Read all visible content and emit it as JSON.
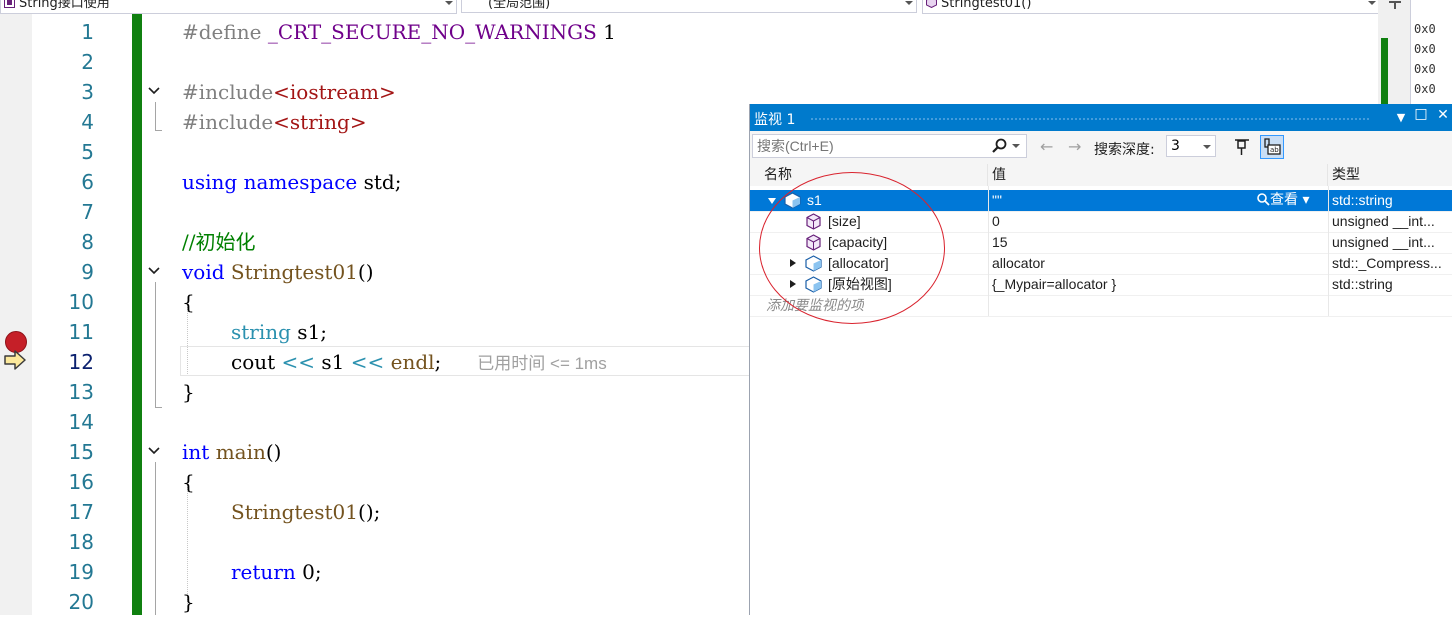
{
  "navbar": {
    "project": "String接口使用",
    "scope": "(全局范围)",
    "member": "Stringtest01()"
  },
  "editor": {
    "line_numbers": [
      "1",
      "2",
      "3",
      "4",
      "5",
      "6",
      "7",
      "8",
      "9",
      "10",
      "11",
      "12",
      "13",
      "14",
      "15",
      "16",
      "17",
      "18",
      "19",
      "20"
    ],
    "current_line": "12",
    "perf_tip": "已用时间 <= 1ms",
    "lines": {
      "l1": {
        "a": "#define ",
        "b": "_CRT_SECURE_NO_WARNINGS",
        "c": " 1"
      },
      "l3": {
        "a": "#include",
        "b": "<iostream>"
      },
      "l4": {
        "a": "#include",
        "b": "<string>"
      },
      "l6": {
        "a": "using",
        "b": " ",
        "c": "namespace",
        "d": " std;"
      },
      "l8": {
        "a": "//初始化"
      },
      "l9": {
        "a": "void",
        "b": " ",
        "c": "Stringtest01",
        "d": "()"
      },
      "l10": {
        "a": "{"
      },
      "l11": {
        "a": "string",
        "b": " s1;"
      },
      "l12": {
        "a": "cout ",
        "b": "<<",
        "c": " s1 ",
        "d": "<<",
        "e": " ",
        "f": "endl",
        "g": ";"
      },
      "l13": {
        "a": "}"
      },
      "l15": {
        "a": "int",
        "b": " ",
        "c": "main",
        "d": "()"
      },
      "l16": {
        "a": "{"
      },
      "l17": {
        "a": "Stringtest01",
        "b": "();"
      },
      "l19": {
        "a": "return",
        "b": " 0;"
      },
      "l20": {
        "a": "}"
      }
    }
  },
  "memory_strip": [
    "0x0",
    "0x0",
    "0x0",
    "0x0"
  ],
  "watch": {
    "title": "监视 1",
    "search_placeholder": "搜索(Ctrl+E)",
    "depth_label": "搜索深度:",
    "depth_value": "3",
    "columns": {
      "name": "名称",
      "value": "值",
      "type": "类型"
    },
    "view_label": "查看",
    "add_item": "添加要监视的项",
    "rows": [
      {
        "name": "s1",
        "value": "\"\"",
        "type": "std::string"
      },
      {
        "name": "[size]",
        "value": "0",
        "type": "unsigned __int..."
      },
      {
        "name": "[capacity]",
        "value": "15",
        "type": "unsigned __int..."
      },
      {
        "name": "[allocator]",
        "value": "allocator",
        "type": "std::_Compress..."
      },
      {
        "name": "[原始视图]",
        "value": "{_Mypair=allocator }",
        "type": "std::string"
      }
    ]
  },
  "colors": {
    "keyword": "#0000ff",
    "type": "#2b91af",
    "macro": "#6f008a",
    "include_path": "#a31515",
    "comment": "#008000",
    "function": "#74531f",
    "title_bar": "#007acc",
    "selection": "#0078d7",
    "breakpoint": "#c51f28",
    "annotation": "#d9232e"
  }
}
